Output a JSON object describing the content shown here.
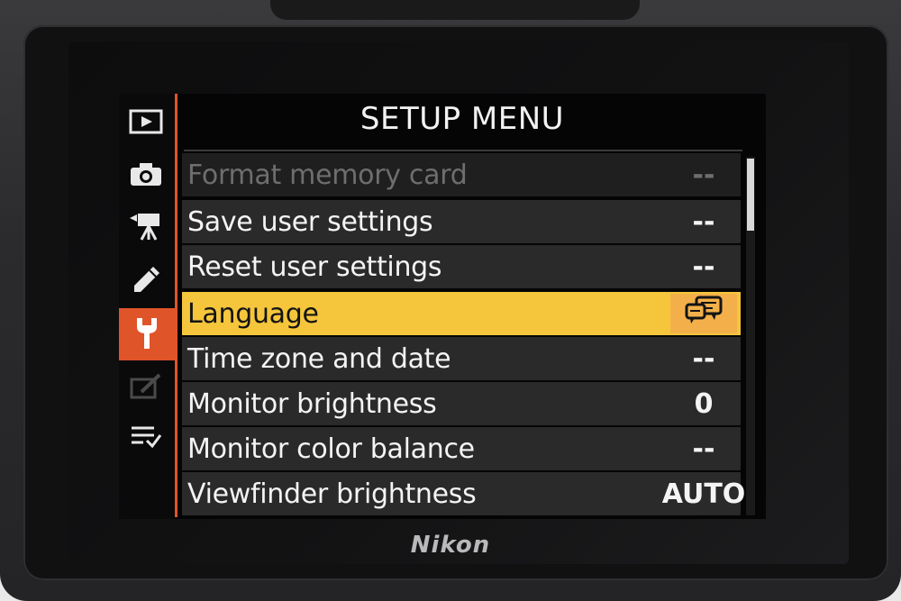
{
  "screen": {
    "title": "SETUP MENU",
    "brand": "Nikon"
  },
  "rail": [
    {
      "icon": "playback-icon",
      "active": false
    },
    {
      "icon": "camera-icon",
      "active": false
    },
    {
      "icon": "movie-camera-icon",
      "active": false
    },
    {
      "icon": "pencil-icon",
      "active": false
    },
    {
      "icon": "wrench-icon",
      "active": true
    },
    {
      "icon": "retouch-icon",
      "active": false,
      "dim": true
    },
    {
      "icon": "my-menu-icon",
      "active": false
    }
  ],
  "menu": {
    "rows": [
      {
        "label": "Format memory card",
        "value": "--",
        "state": "disabled"
      },
      {
        "label": "Save user settings",
        "value": "--",
        "state": "normal"
      },
      {
        "label": "Reset user settings",
        "value": "--",
        "state": "normal"
      },
      {
        "label": "Language",
        "value": "",
        "value_icon": "speech-bubbles-icon",
        "state": "selected"
      },
      {
        "label": "Time zone and date",
        "value": "--",
        "state": "normal"
      },
      {
        "label": "Monitor brightness",
        "value": "0",
        "state": "normal"
      },
      {
        "label": "Monitor color balance",
        "value": "--",
        "state": "normal"
      },
      {
        "label": "Viewfinder brightness",
        "value": "AUTO",
        "state": "normal"
      }
    ]
  },
  "colors": {
    "accent": "#e0542a",
    "selection": "#f5c63c",
    "selection_value": "#f3b04a",
    "row_bg": "#2a2a2a",
    "text": "#f4f4f4",
    "disabled_text": "#6e6e6e"
  }
}
